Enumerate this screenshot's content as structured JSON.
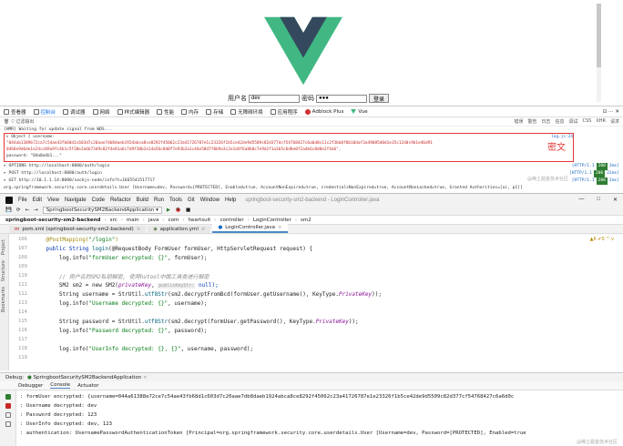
{
  "vue_page": {
    "username_label": "用户名",
    "username_value": "dev",
    "password_label": "密码",
    "password_value": "●●●",
    "login_button": "登录"
  },
  "devtools": {
    "tabs": [
      "查看器",
      "控制台",
      "调试器",
      "网络",
      "样式编辑器",
      "性能",
      "内存",
      "存储",
      "无障碍环境",
      "应用程序",
      "Adblock Plus",
      "Vue"
    ],
    "active_tab": "控制台",
    "right_icons": "⊡ ⋯ ✕",
    "filter_placeholder": "过滤输出",
    "levels": [
      "错误",
      "警告",
      "日志",
      "信息",
      "调试",
      "CSS",
      "XHR",
      "请求"
    ],
    "console_lines": [
      "[HMR] Waiting for update signal from WDS...",
      "▸ Object { username:"
    ],
    "log_source": "log.js:24",
    "encrypted_lines": [
      "\"044ab1389b72ca7c54ae43fb68d1c603d7c20aae7db8daeb1924abca8ce8292f45062c23a41726787e1c23326f1b5ce42de9d5509c82d377dcf54768427c6a6d0c11c2f3bb0f8b10daf3a49085d0d1e35c12d0c9b1e46d91",
      "0468e9d6de1e24cc09a9fc4b1c5f38e2a6b73d9c02f4e81a6c7d9f30b2e14a56c8d0f7e93b2a1c46e58d7f0b9a3c2e1d4f6a8b0c7e9d2f1a3b5c6d8e0f2a4b6c8d0e2f4a6\","
    ],
    "password_field": "password: \"04a0a4b1...\"",
    "miwen_label": "密文",
    "net_lines": [
      {
        "method": "OPTIONS",
        "url": "http://localhost:8080/auth/login",
        "status": "200",
        "proto": "[HTTP/1.1",
        "time": "3ms]"
      },
      {
        "method": "POST",
        "url": "http://localhost:8080/auth/login",
        "status": "200",
        "proto": "[HTTP/1.1",
        "time": "22ms]"
      },
      {
        "method": "GET",
        "url": "http://10.1.1.14:8080/sockjs-node/info?t=1665541517717",
        "status": "200",
        "proto": "[HTTP/1.1",
        "time": "1ms]"
      }
    ],
    "auth_line": "org.springframework.security.core.userdetails.User [Username=dev, Password=[PROTECTED], Enabled=true, AccountNonExpired=true, credentialsNonExpired=true, AccountNonLocked=true, Granted Authorities=[ui, p1]]",
    "watermark": "@稀土掘金技术社区"
  },
  "ide": {
    "menu": [
      "File",
      "Edit",
      "View",
      "Navigate",
      "Code",
      "Refactor",
      "Build",
      "Run",
      "Tools",
      "Git",
      "Window",
      "Help"
    ],
    "window_title": "springboot-security-sm2-backend - LoginController.java",
    "window_controls": [
      "—",
      "□",
      "✕"
    ],
    "run_config": "SpringbootSecuritySM2BackendApplication ▾",
    "breadcrumb": [
      "springboot-security-sm2-backend",
      "src",
      "main",
      "java",
      "com",
      "heartsuit",
      "controller",
      "LoginController",
      "sm2"
    ],
    "file_tabs": [
      "pom.xml (springboot-security-sm2-backend)",
      "application.yml",
      "LoginController.java"
    ],
    "active_file": "LoginController.java",
    "editor_status": "▲6 ✔0 ^ v",
    "side_labels": [
      "Project",
      "Structure",
      "Bookmarks"
    ],
    "line_numbers": [
      "106",
      "107",
      "108",
      "109",
      "110",
      "111",
      "112",
      "113",
      "114",
      "115",
      "116",
      "117",
      "118",
      "119"
    ],
    "code": {
      "l106_ann": "@PostMapping(",
      "l106_str": "\"/login\"",
      "l106_end": ")",
      "l107_a": "public String ",
      "l107_m": "login",
      "l107_b": "(@RequestBody FormUser formUser, HttpServletRequest request) {",
      "l108_a": "    log.info(",
      "l108_str": "\"formUser encrypted: {}\"",
      "l108_b": ", formUser);",
      "l110_cm": "    // 用户名的SM2私钥解密, 使用hutool中国工具类进行解密",
      "l111_a": "    SM2 sm2 = new SM2(",
      "l111_f": "privateKey",
      "l111_hint": "publicKeyStr:",
      "l111_b": " null);",
      "l112_a": "    String username = StrUtil.",
      "l112_m": "utf8Str",
      "l112_b": "(sm2.decryptFromBcd(formUser.getUsername(), KeyType.",
      "l112_f": "PrivateKey",
      "l112_c": "));",
      "l113_a": "    log.info(",
      "l113_str": "\"Username decrypted: {}\"",
      "l113_b": ", username);",
      "l115_a": "    String password = StrUtil.",
      "l115_m": "utf8Str",
      "l115_b": "(sm2.decrypt(formUser.getPassword(), KeyType.",
      "l115_f": "PrivateKey",
      "l115_c": "));",
      "l116_a": "    log.info(",
      "l116_str": "\"Password decrypted: {}\"",
      "l116_b": ", password);",
      "l118_a": "    log.info(",
      "l118_str": "\"UserInfo decrypted: {}, {}\"",
      "l118_b": ", username, password);"
    },
    "debug": {
      "label": "Debug:",
      "session": "SpringbootSecuritySM2BackendApplication",
      "tabs": [
        "Debugger",
        "Console",
        "Actuator"
      ],
      "active_tab": "Console",
      "output": [
        ": formUser encrypted: {username=044a61388e72ce7c54ae43fb68d1c603d7c20aae7db8daeb1924abca8ce8292f45062c23a41726787e1e23326f1b5ce42de9d5509c82d377cf54768427c6a6d0c",
        ": Username decrypted: dev",
        ": Password decrypted: 123",
        ": UserInfo decrypted: dev, 123",
        ": authentication: UsernamePasswordAuthenticationToken [Principal=org.springframework.security.core.userdetails.User [Username=dev, Password=[PROTECTED], Enabled=true"
      ],
      "watermark": "@稀土掘金技术社区"
    }
  }
}
